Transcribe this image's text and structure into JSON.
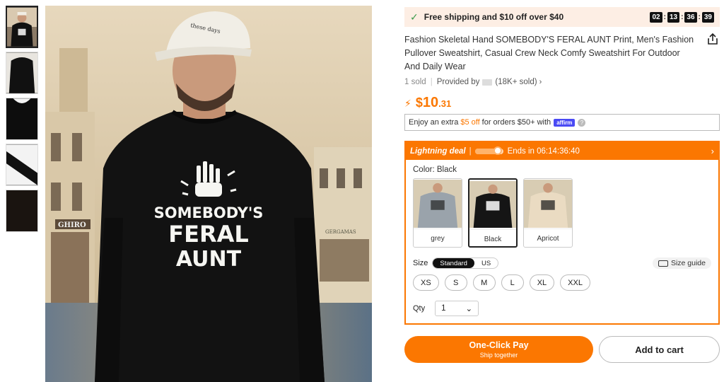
{
  "thumbnails": [
    {
      "label": "thumbnail-1"
    },
    {
      "label": "thumbnail-2"
    },
    {
      "label": "thumbnail-3"
    },
    {
      "label": "thumbnail-4"
    },
    {
      "label": "thumbnail-5"
    }
  ],
  "main_image": {
    "cap_text": "these days",
    "shirt_text_line1": "SOMEBODY'S",
    "shirt_text_line2": "FERAL",
    "shirt_text_line3": "AUNT",
    "sign_text": "GHIRO",
    "sign_text2": "GERGAMAS"
  },
  "promo": {
    "text": "Free shipping and $10 off over $40",
    "timer": [
      "02",
      "13",
      "36",
      "39"
    ]
  },
  "product": {
    "title": "Fashion Skeletal Hand SOMEBODY'S FERAL AUNT Print, Men's Fashion Pullover Sweatshirt, Casual Crew Neck Comfy Sweatshirt For Outdoor And Daily Wear",
    "sold": "1 sold",
    "provided_by": "Provided by",
    "store_sold": "(18K+ sold)"
  },
  "price": {
    "currency": "$",
    "integer": "10",
    "decimal": ".31"
  },
  "affirm": {
    "prefix": "Enjoy an extra",
    "amount": "$5 off",
    "suffix": "for orders $50+ with",
    "logo": "affirm"
  },
  "deal": {
    "title": "Lightning deal",
    "separator": "|",
    "ends": "Ends in 06:14:36:40",
    "progress": 0.85
  },
  "color": {
    "label": "Color: Black",
    "options": [
      {
        "name": "grey",
        "color": "#9aa3ab"
      },
      {
        "name": "Black",
        "color": "#151515"
      },
      {
        "name": "Apricot",
        "color": "#eadbc2"
      }
    ],
    "selected": "Black"
  },
  "size": {
    "label": "Size",
    "toggle": [
      "Standard",
      "US"
    ],
    "guide": "Size guide",
    "options": [
      "XS",
      "S",
      "M",
      "L",
      "XL",
      "XXL"
    ]
  },
  "qty": {
    "label": "Qty",
    "value": "1"
  },
  "buttons": {
    "one_click": "One-Click Pay",
    "one_click_sub": "Ship together",
    "add_to_cart": "Add to cart"
  },
  "colors": {
    "accent": "#fb7701",
    "promo_bg": "#fdeee4",
    "check": "#3a9a4b",
    "affirm": "#4a4af4"
  }
}
